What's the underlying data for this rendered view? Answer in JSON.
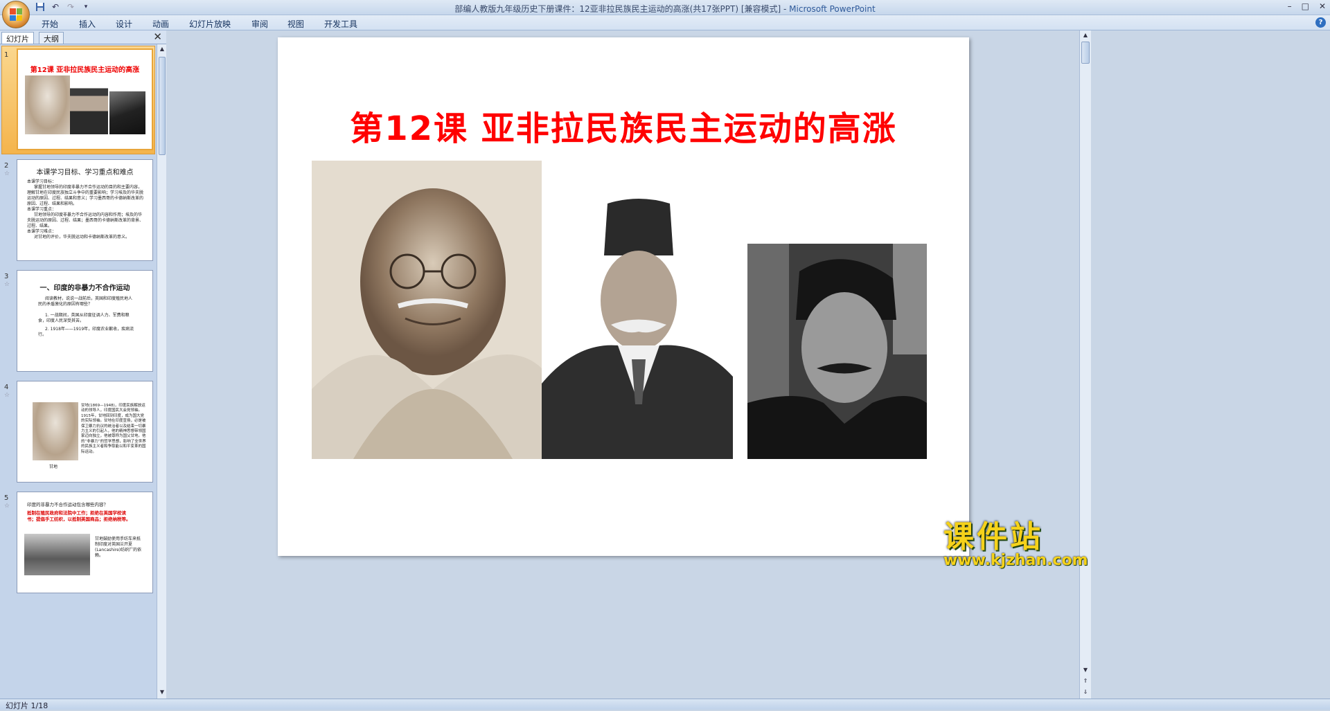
{
  "window": {
    "title_doc": "部编人教版九年级历史下册课件：12亚非拉民族民主运动的高涨(共17张PPT) [兼容模式]",
    "title_sep": " - ",
    "title_app": "Microsoft PowerPoint",
    "minimize": "–",
    "maximize": "□",
    "close": "✕"
  },
  "ribbon": {
    "tabs": [
      "开始",
      "插入",
      "设计",
      "动画",
      "幻灯片放映",
      "审阅",
      "视图",
      "开发工具"
    ],
    "help": "?"
  },
  "panel": {
    "tab_slides": "幻灯片",
    "tab_outline": "大纲",
    "close": "✕"
  },
  "thumbnails": [
    {
      "num": "1",
      "title": "第12课  亚非拉民族民主运动的高涨"
    },
    {
      "num": "2",
      "title": "本课学习目标、学习重点和难点",
      "lines": [
        "本课学习目标：",
        "掌握甘地领导的印度非暴力不合作运动的目的和主要内容，理解甘地在印度民族独立斗争中的重要影响；学习埃及的华夫脱运动的原因、过程、结果和意义；学习墨西哥的卡德纳斯改革的原因、过程、结果和影响。",
        "本课学习重点：",
        "甘地领导的印度非暴力不合作运动的内容和作用；埃及的华夫脱运动的原因、过程、结果；墨西哥的卡德纳斯改革的背景、过程、结果。",
        "本课学习难点：",
        "对甘地的评价，华夫脱运动和卡德纳斯改革的意义。"
      ]
    },
    {
      "num": "3",
      "title": "一、印度的非暴力不合作运动",
      "lines": [
        "阅读教材，说说一战前后，英国和印度殖民地人民的矛盾激化的原因有哪些？",
        "1. 一战期间，英国从印度征调人力、军费和粮食，印度人民深受其苦。",
        "2. 1918年——1919年，印度农业歉收，疾病流行。"
      ]
    },
    {
      "num": "4",
      "caption": "甘地",
      "lines": [
        "甘地(1869—1948)，印度民族解放运动的领导人，印度国民大会党领袖。1915年，甘地回到印度，成为国大党的实际领袖。甘地在印度宣扬，必是被保卫暴力抗议的统治者以及结束一切暴力主义的引起人，他的精神思想带领国家迈向独立，他被尊称为国父甘地。他的“非暴力”的哲学思想，影响了全世界的民族主义者和争取能以和平变革的国际运动。"
      ]
    },
    {
      "num": "5",
      "title": "印度的非暴力不合作运动包含哪些内容？",
      "red": "抵制在殖民政府和法院中工作；拒绝在英国学校读书；提倡手工纺织，以抵制英国商品；拒绝纳税等。",
      "lines": [
        "甘地鼓励使用手纺车来抵制印度对英国兰开夏(Lancashire)纺织厂的依赖。"
      ]
    }
  ],
  "slide": {
    "title": "第12课  亚非拉民族民主运动的高涨"
  },
  "status": {
    "slide_indicator": "幻灯片 1/18"
  },
  "watermark": {
    "main": "课件站",
    "url": "www.kjzhan.com"
  }
}
